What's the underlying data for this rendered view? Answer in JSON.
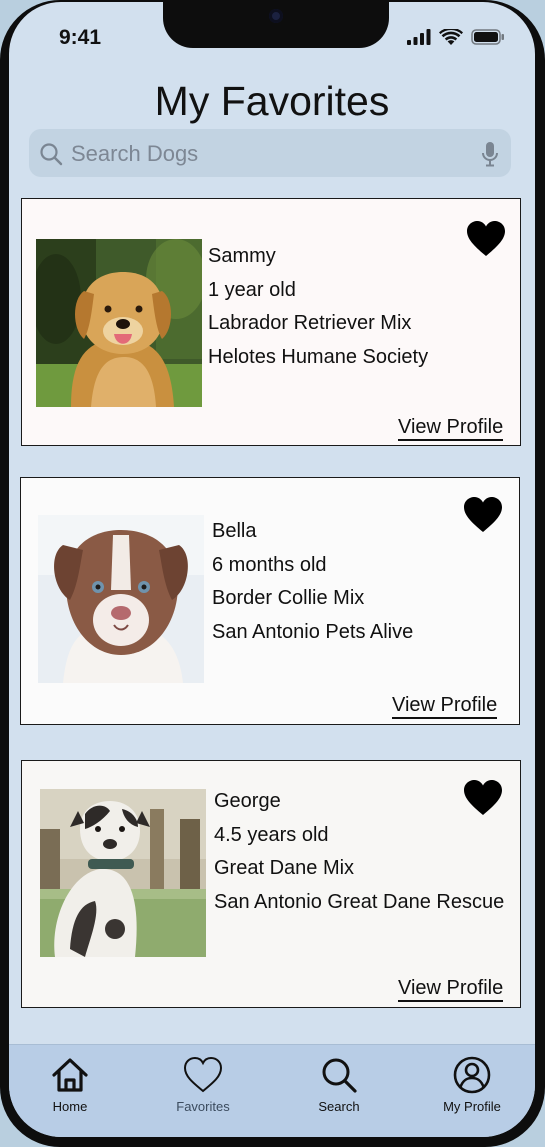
{
  "status": {
    "time": "9:41"
  },
  "page": {
    "title": "My Favorites"
  },
  "search": {
    "placeholder": "Search Dogs"
  },
  "colors": {
    "background": "#d2e0ee",
    "tabbar": "#b8cde6",
    "card": "#fdf9f9",
    "search": "#c2d3e2"
  },
  "dogs": [
    {
      "name": "Sammy",
      "age": "1 year old",
      "breed": "Labrador Retriever Mix",
      "shelter": "Helotes Humane Society",
      "link": "View Profile",
      "photo": "golden-retriever-photo"
    },
    {
      "name": "Bella",
      "age": "6 months old",
      "breed": "Border Collie Mix",
      "shelter": "San Antonio Pets Alive",
      "link": "View Profile",
      "photo": "border-collie-puppy-photo"
    },
    {
      "name": "George",
      "age": "4.5 years old",
      "breed": "Great Dane Mix",
      "shelter": "San Antonio Great Dane Rescue",
      "link": "View Profile",
      "photo": "great-dane-photo"
    }
  ],
  "tabs": [
    {
      "label": "Home",
      "icon": "home-icon"
    },
    {
      "label": "Favorites",
      "icon": "heart-outline-icon"
    },
    {
      "label": "Search",
      "icon": "search-icon"
    },
    {
      "label": "My Profile",
      "icon": "profile-icon"
    }
  ]
}
